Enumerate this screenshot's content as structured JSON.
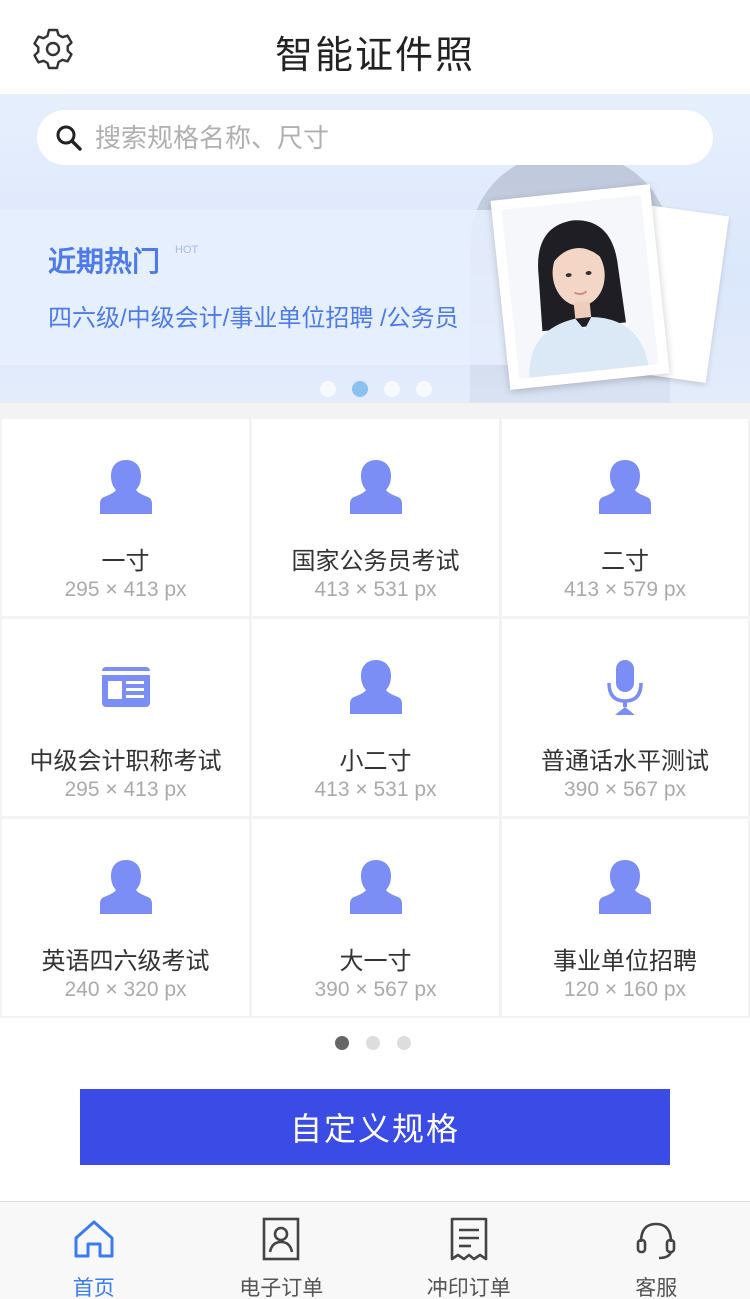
{
  "header": {
    "title": "智能证件照",
    "settings_icon": "gear-icon"
  },
  "search": {
    "placeholder": "搜索规格名称、尺寸",
    "value": ""
  },
  "banner": {
    "hot_title": "近期热门",
    "hot_badge": "HOT",
    "hot_subtitle": "四六级/中级会计/事业单位招聘 /公务员",
    "dots": 4,
    "active_dot": 1
  },
  "specs": [
    {
      "icon": "person-icon",
      "name": "一寸",
      "size": "295 × 413 px"
    },
    {
      "icon": "person-icon",
      "name": "国家公务员考试",
      "size": "413 × 531 px"
    },
    {
      "icon": "person-icon",
      "name": "二寸",
      "size": "413 × 579 px"
    },
    {
      "icon": "id-card-icon",
      "name": "中级会计职称考试",
      "size": "295 × 413 px"
    },
    {
      "icon": "person-icon",
      "name": "小二寸",
      "size": "413 × 531 px"
    },
    {
      "icon": "microphone-icon",
      "name": "普通话水平测试",
      "size": "390 × 567 px"
    },
    {
      "icon": "person-icon",
      "name": "英语四六级考试",
      "size": "240 × 320 px"
    },
    {
      "icon": "person-icon",
      "name": "大一寸",
      "size": "390 × 567 px"
    },
    {
      "icon": "person-icon",
      "name": "事业单位招聘",
      "size": "120 × 160 px"
    }
  ],
  "pagination": {
    "pages": 3,
    "active": 0
  },
  "custom_button": "自定义规格",
  "tabs": [
    {
      "label": "首页",
      "icon": "home-icon",
      "active": true
    },
    {
      "label": "电子订单",
      "icon": "id-badge-icon",
      "active": false
    },
    {
      "label": "冲印订单",
      "icon": "receipt-icon",
      "active": false
    },
    {
      "label": "客服",
      "icon": "customer-service-icon",
      "active": false
    }
  ],
  "colors": {
    "accent": "#3b4ce6",
    "icon": "#7a8ef5",
    "banner_text": "#4f7be8",
    "tab_active": "#3b7bf0"
  }
}
